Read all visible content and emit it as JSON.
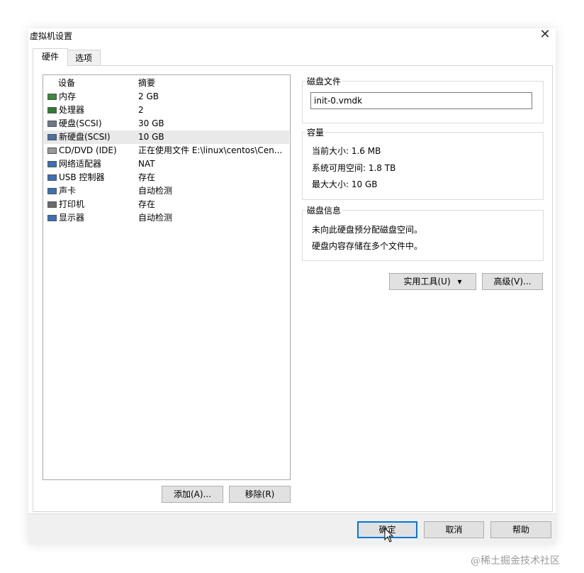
{
  "window": {
    "title": "虚拟机设置",
    "close_glyph": "✕"
  },
  "tabs": [
    {
      "label": "硬件",
      "active": true
    },
    {
      "label": "选项",
      "active": false
    }
  ],
  "device_list": {
    "columns": {
      "device": "设备",
      "summary": "摘要"
    },
    "rows": [
      {
        "name": "内存",
        "summary": "2 GB",
        "icon": "memory-icon",
        "icon_color": "#3a8a3a",
        "selected": false
      },
      {
        "name": "处理器",
        "summary": "2",
        "icon": "processor-icon",
        "icon_color": "#2e7d32",
        "selected": false
      },
      {
        "name": "硬盘(SCSI)",
        "summary": "30 GB",
        "icon": "hard-disk-icon",
        "icon_color": "#6b7b8c",
        "selected": false
      },
      {
        "name": "新硬盘(SCSI)",
        "summary": "10 GB",
        "icon": "hard-disk-icon",
        "icon_color": "#4a6ea8",
        "selected": true
      },
      {
        "name": "CD/DVD (IDE)",
        "summary": "正在使用文件 E:\\linux\\centos\\Cen...",
        "icon": "cd-dvd-icon",
        "icon_color": "#9a9a9a",
        "selected": false
      },
      {
        "name": "网络适配器",
        "summary": "NAT",
        "icon": "network-adapter-icon",
        "icon_color": "#3b6fb6",
        "selected": false
      },
      {
        "name": "USB 控制器",
        "summary": "存在",
        "icon": "usb-icon",
        "icon_color": "#3b6fb6",
        "selected": false
      },
      {
        "name": "声卡",
        "summary": "自动检测",
        "icon": "sound-card-icon",
        "icon_color": "#3b6fb6",
        "selected": false
      },
      {
        "name": "打印机",
        "summary": "存在",
        "icon": "printer-icon",
        "icon_color": "#6b6b6b",
        "selected": false
      },
      {
        "name": "显示器",
        "summary": "自动检测",
        "icon": "monitor-icon",
        "icon_color": "#3b6fb6",
        "selected": false
      }
    ]
  },
  "list_buttons": {
    "add": "添加(A)...",
    "remove": "移除(R)"
  },
  "disk_file": {
    "label": "磁盘文件",
    "value": "init-0.vmdk"
  },
  "capacity": {
    "label": "容量",
    "current_size": "当前大小: 1.6 MB",
    "system_free": "系统可用空间: 1.8 TB",
    "max_size": "最大大小: 10 GB"
  },
  "disk_info": {
    "label": "磁盘信息",
    "line1": "未向此硬盘预分配磁盘空间。",
    "line2": "硬盘内容存储在多个文件中。"
  },
  "tools_buttons": {
    "utilities": "实用工具(U)",
    "utilities_arrow": "▾",
    "advanced": "高级(V)..."
  },
  "footer_buttons": {
    "ok": "确定",
    "cancel": "取消",
    "help": "帮助"
  },
  "watermark": "@稀土掘金技术社区"
}
